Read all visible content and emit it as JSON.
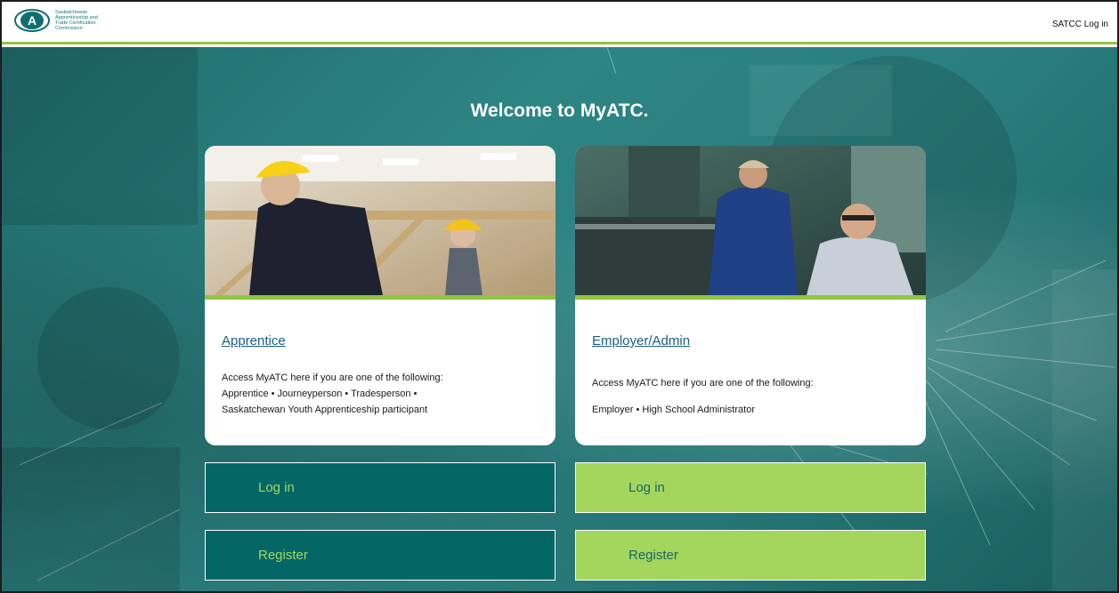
{
  "header": {
    "org_name_lines": [
      "Saskatchewan",
      "Apprenticeship and",
      "Trade Certification",
      "Commission"
    ],
    "logo_letter": "A",
    "login_link": "SATCC Log in"
  },
  "main": {
    "welcome": "Welcome to MyATC."
  },
  "cards": {
    "apprentice": {
      "title": "Apprentice",
      "desc_line1": "Access MyATC here if you are one of the following:",
      "desc_line2": "Apprentice • Journeyperson • Tradesperson •",
      "desc_line3": "Saskatchewan Youth Apprenticeship participant",
      "login_label": "Log in",
      "register_label": "Register"
    },
    "employer": {
      "title": "Employer/Admin",
      "desc_line1": "Access MyATC here if you are one of the following:",
      "desc_line2": "Employer • High School Administrator",
      "login_label": "Log in",
      "register_label": "Register"
    }
  },
  "colors": {
    "teal": "#046766",
    "lime": "#a4d65e",
    "link_blue": "#1a5e86",
    "accent_green": "#8fc640"
  },
  "icons": [
    "satcc-logo-icon"
  ]
}
